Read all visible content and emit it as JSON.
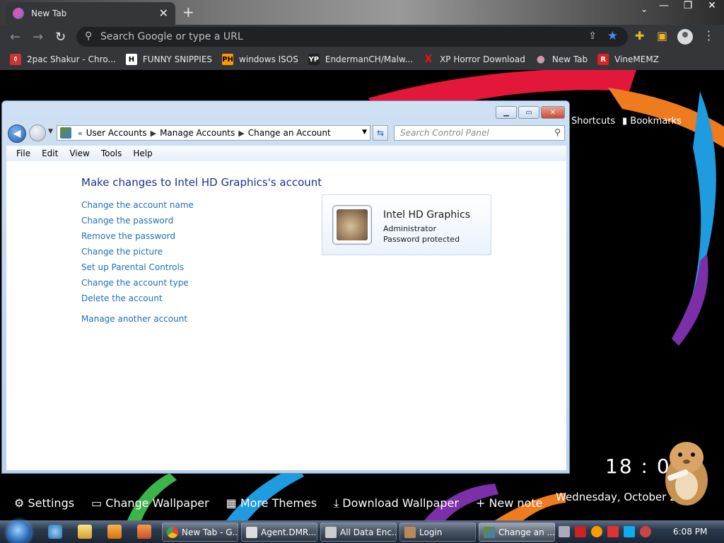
{
  "chrome": {
    "tab_title": "New Tab",
    "tab_close": "✕",
    "new_tab": "+",
    "omnibox_placeholder": "Search Google or type a URL",
    "bookmarks": [
      {
        "label": "2pac Shakur - Chro...",
        "icon": "⚱"
      },
      {
        "label": "FUNNY SNIPPIES",
        "icon": "H"
      },
      {
        "label": "windows ISOS",
        "icon": "PH"
      },
      {
        "label": "EndermanCH/Malw...",
        "icon": "YP"
      },
      {
        "label": "XP Horror Download",
        "icon": "X"
      },
      {
        "label": "New Tab",
        "icon": "●"
      },
      {
        "label": "VineMEMZ",
        "icon": "R"
      }
    ]
  },
  "ntp": {
    "shortcuts": "Shortcuts",
    "bookmarks": "Bookmarks",
    "clock": "18 : 08",
    "date": "Wednesday, October 2",
    "bottom": {
      "settings": "Settings",
      "change_wallpaper": "Change Wallpaper",
      "more_themes": "More Themes",
      "download_wallpaper": "Download Wallpaper",
      "new_note": "+ New note"
    }
  },
  "window": {
    "breadcrumb": [
      "User Accounts",
      "Manage Accounts",
      "Change an Account"
    ],
    "breadcrumb_prefix": "«",
    "search_placeholder": "Search Control Panel",
    "menu": [
      "File",
      "Edit",
      "View",
      "Tools",
      "Help"
    ],
    "heading": "Make changes to Intel HD Graphics's account",
    "links": [
      "Change the account name",
      "Change the password",
      "Remove the password",
      "Change the picture",
      "Set up Parental Controls",
      "Change the account type",
      "Delete the account"
    ],
    "manage_another": "Manage another account",
    "account": {
      "name": "Intel HD Graphics",
      "type": "Administrator",
      "status": "Password protected"
    }
  },
  "taskbar": {
    "tasks": [
      "New Tab - G...",
      "Agent.DMR...",
      "All Data Enc...",
      "Login",
      "Change an ..."
    ],
    "time": "6:08 PM"
  }
}
